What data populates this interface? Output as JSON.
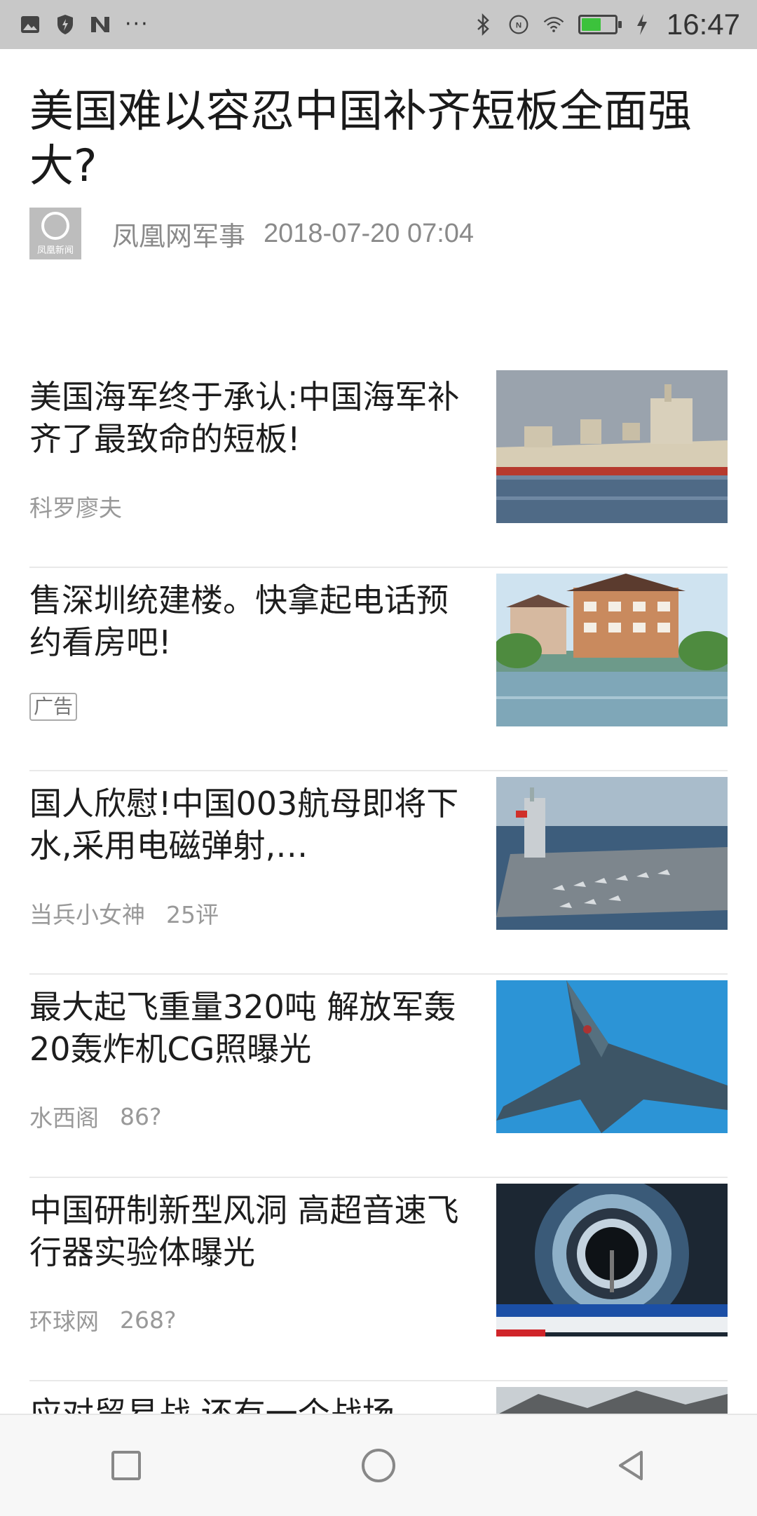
{
  "status_bar": {
    "time": "16:47",
    "left_icons": [
      "image-icon",
      "shield-icon",
      "n-app-icon"
    ],
    "more": "···",
    "right_icons": [
      "bluetooth-icon",
      "nfc-icon",
      "wifi-icon",
      "battery-icon",
      "charging-icon"
    ],
    "battery_level": 0.55
  },
  "article": {
    "title": "美国难以容忍中国补齐短板全面强大?",
    "source": "凤凰网军事",
    "datetime": "2018-07-20 07:04",
    "logo_text": "凤凰新闻"
  },
  "feed": [
    {
      "title": "美国海军终于承认:中国海军补齐了最致命的短板!",
      "source": "科罗廖夫",
      "comments": "",
      "ad": false,
      "ad_label": ""
    },
    {
      "title": "售深圳统建楼。快拿起电话预约看房吧!",
      "source": "",
      "comments": "",
      "ad": true,
      "ad_label": "广告"
    },
    {
      "title": "国人欣慰!中国003航母即将下水,采用电磁弹射,…",
      "source": "当兵小女神",
      "comments": "25评",
      "ad": false,
      "ad_label": ""
    },
    {
      "title": "最大起飞重量320吨 解放军轰20轰炸机CG照曝光",
      "source": "水西阁",
      "comments": "86?",
      "ad": false,
      "ad_label": ""
    },
    {
      "title": "中国研制新型风洞 高超音速飞行器实验体曝光",
      "source": "环球网",
      "comments": "268?",
      "ad": false,
      "ad_label": ""
    },
    {
      "title": "应对贸易战 还有一个战场",
      "source": "",
      "comments": "",
      "ad": false,
      "ad_label": ""
    }
  ],
  "nav_bar": {
    "buttons": [
      "recent-apps",
      "home",
      "back"
    ]
  },
  "colors": {
    "status_bar_bg": "#c8c8c8",
    "meta_text": "#999999",
    "battery_fill": "#3cc23c"
  }
}
